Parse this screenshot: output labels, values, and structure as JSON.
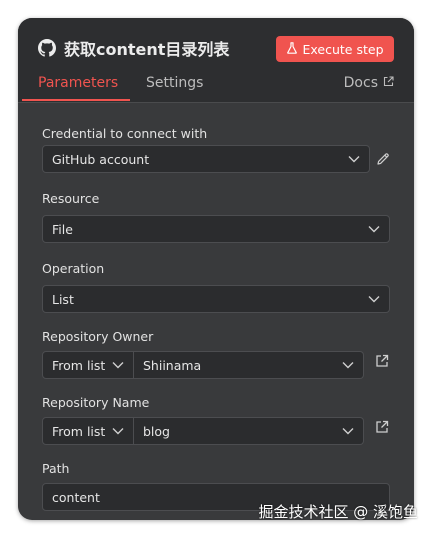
{
  "header": {
    "title": "获取content目录列表",
    "execute_label": "Execute step"
  },
  "tabs": {
    "parameters": "Parameters",
    "settings": "Settings",
    "docs": "Docs"
  },
  "fields": {
    "credential": {
      "label": "Credential to connect with",
      "value": "GitHub account"
    },
    "resource": {
      "label": "Resource",
      "value": "File"
    },
    "operation": {
      "label": "Operation",
      "value": "List"
    },
    "owner": {
      "label": "Repository Owner",
      "mode": "From list",
      "value": "Shiinama"
    },
    "repo": {
      "label": "Repository Name",
      "mode": "From list",
      "value": "blog"
    },
    "path": {
      "label": "Path",
      "value": "content"
    }
  },
  "watermark": "掘金技术社区 @ 溪饱鱼",
  "colors": {
    "accent": "#f0544f",
    "panel_bg": "#393a3c",
    "header_bg": "#2d2e30",
    "input_bg": "#2b2c2e"
  }
}
